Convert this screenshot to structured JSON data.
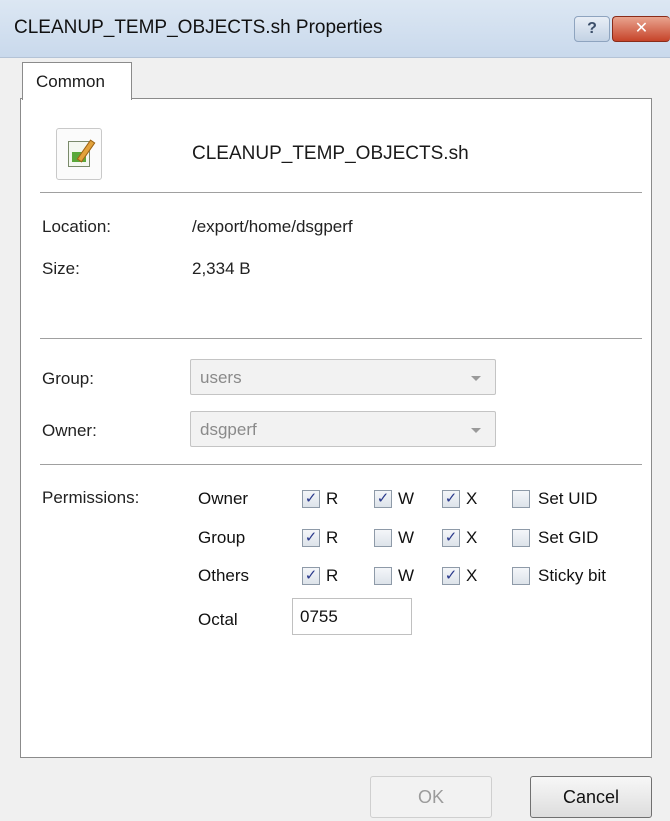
{
  "window": {
    "title": "CLEANUP_TEMP_OBJECTS.sh Properties",
    "help_label": "?",
    "close_label": "✕"
  },
  "tabs": [
    {
      "label": "Common",
      "active": true
    }
  ],
  "file": {
    "name": "CLEANUP_TEMP_OBJECTS.sh",
    "icon": "script-file-icon"
  },
  "details": {
    "location_label": "Location:",
    "location_value": "/export/home/dsgperf",
    "size_label": "Size:",
    "size_value": "2,334 B"
  },
  "ownership": {
    "group_label": "Group:",
    "group_value": "users",
    "owner_label": "Owner:",
    "owner_value": "dsgperf"
  },
  "permissions": {
    "label": "Permissions:",
    "rows": [
      {
        "label": "Owner",
        "r": true,
        "w": true,
        "x": true,
        "special_label": "Set UID",
        "special": false
      },
      {
        "label": "Group",
        "r": true,
        "w": false,
        "x": true,
        "special_label": "Set GID",
        "special": false
      },
      {
        "label": "Others",
        "r": true,
        "w": false,
        "x": true,
        "special_label": "Sticky bit",
        "special": false
      }
    ],
    "r_label": "R",
    "w_label": "W",
    "x_label": "X",
    "octal_label": "Octal",
    "octal_value": "0755"
  },
  "buttons": {
    "ok_label": "OK",
    "cancel_label": "Cancel"
  }
}
